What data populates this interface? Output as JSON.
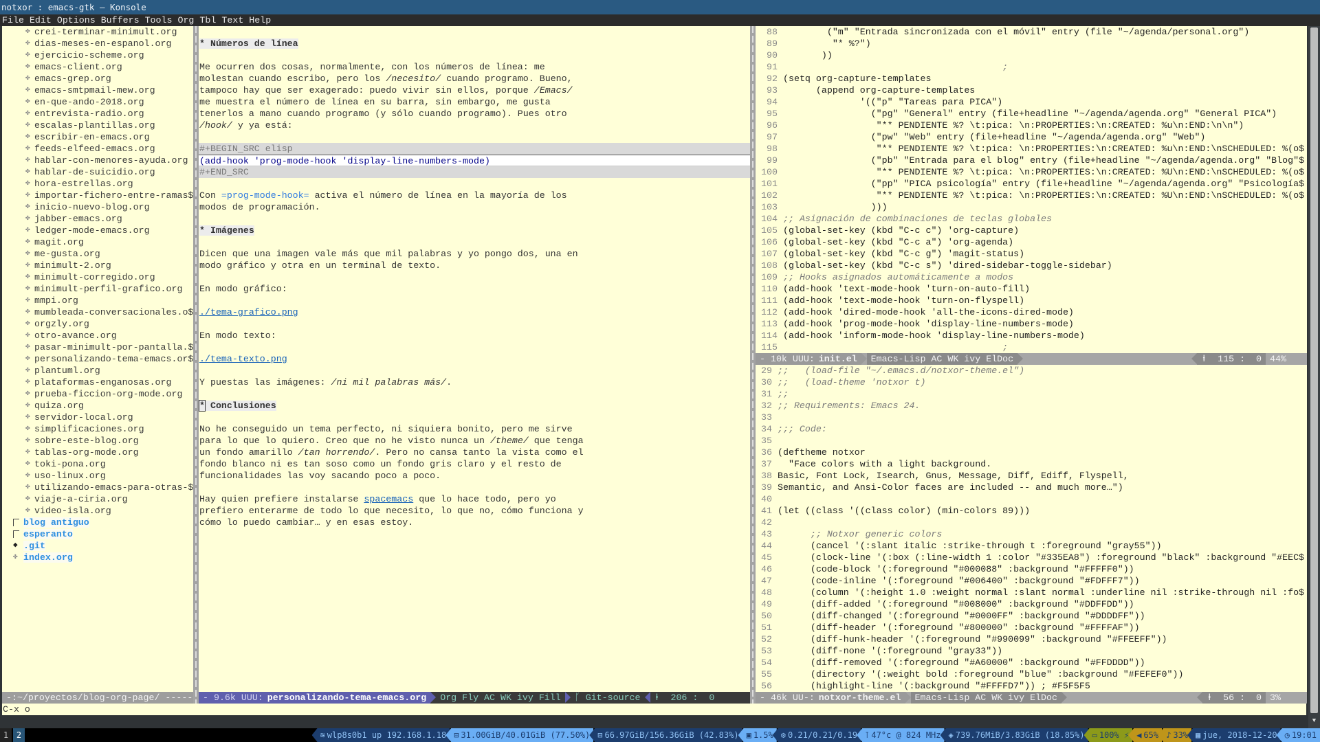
{
  "window": {
    "title": "notxor : emacs-gtk — Konsole"
  },
  "menu": [
    "File",
    "Edit",
    "Options",
    "Buffers",
    "Tools",
    "Org",
    "Tbl",
    "Text",
    "Help"
  ],
  "sidebar": {
    "items": [
      {
        "name": "crei-terminar-minimult.org",
        "type": "file"
      },
      {
        "name": "dias-meses-en-espanol.org",
        "type": "file"
      },
      {
        "name": "ejercicio-scheme.org",
        "type": "file"
      },
      {
        "name": "emacs-client.org",
        "type": "file"
      },
      {
        "name": "emacs-grep.org",
        "type": "file"
      },
      {
        "name": "emacs-smtpmail-mew.org",
        "type": "file"
      },
      {
        "name": "en-que-ando-2018.org",
        "type": "file"
      },
      {
        "name": "entrevista-radio.org",
        "type": "file"
      },
      {
        "name": "escalas-plantillas.org",
        "type": "file"
      },
      {
        "name": "escribir-en-emacs.org",
        "type": "file"
      },
      {
        "name": "feeds-elfeed-emacs.org",
        "type": "file"
      },
      {
        "name": "hablar-con-menores-ayuda.org",
        "type": "file"
      },
      {
        "name": "hablar-de-suicidio.org",
        "type": "file"
      },
      {
        "name": "hora-estrellas.org",
        "type": "file"
      },
      {
        "name": "importar-fichero-entre-ramas$",
        "type": "file"
      },
      {
        "name": "inicio-nuevo-blog.org",
        "type": "file"
      },
      {
        "name": "jabber-emacs.org",
        "type": "file"
      },
      {
        "name": "ledger-mode-emacs.org",
        "type": "file"
      },
      {
        "name": "magit.org",
        "type": "file"
      },
      {
        "name": "me-gusta.org",
        "type": "file"
      },
      {
        "name": "minimult-2.org",
        "type": "file"
      },
      {
        "name": "minimult-corregido.org",
        "type": "file"
      },
      {
        "name": "minimult-perfil-grafico.org",
        "type": "file"
      },
      {
        "name": "mmpi.org",
        "type": "file"
      },
      {
        "name": "mumbleada-conversacionales.o$",
        "type": "file"
      },
      {
        "name": "orgzly.org",
        "type": "file"
      },
      {
        "name": "otro-avance.org",
        "type": "file"
      },
      {
        "name": "pasar-minimult-por-pantalla.$",
        "type": "file"
      },
      {
        "name": "personalizando-tema-emacs.or$",
        "type": "file"
      },
      {
        "name": "plantuml.org",
        "type": "file"
      },
      {
        "name": "plataformas-enganosas.org",
        "type": "file"
      },
      {
        "name": "prueba-ficcion-org-mode.org",
        "type": "file"
      },
      {
        "name": "quiza.org",
        "type": "file"
      },
      {
        "name": "servidor-local.org",
        "type": "file"
      },
      {
        "name": "simplificaciones.org",
        "type": "file"
      },
      {
        "name": "sobre-este-blog.org",
        "type": "file"
      },
      {
        "name": "tablas-org-mode.org",
        "type": "file"
      },
      {
        "name": "toki-pona.org",
        "type": "file"
      },
      {
        "name": "uso-linux.org",
        "type": "file"
      },
      {
        "name": "utilizando-emacs-para-otras-$",
        "type": "file"
      },
      {
        "name": "viaje-a-ciria.org",
        "type": "file"
      },
      {
        "name": "video-isla.org",
        "type": "file"
      },
      {
        "name": "blog antiguo",
        "type": "dir"
      },
      {
        "name": "esperanto",
        "type": "dir"
      },
      {
        "name": ".git",
        "type": "git"
      },
      {
        "name": "index.org",
        "type": "root-file"
      }
    ],
    "modeline": "-:~/proyectos/blog-org-page/ ------"
  },
  "org_buffer": {
    "lines": [
      {
        "type": "blank",
        "segs": []
      },
      {
        "type": "text",
        "segs": [
          [
            "* Números de línea",
            "h"
          ]
        ]
      },
      {
        "type": "blank",
        "segs": []
      },
      {
        "type": "text",
        "segs": [
          [
            "Me ocurren dos cosas, normalmente, con los números de línea: me",
            ""
          ]
        ]
      },
      {
        "type": "text",
        "segs": [
          [
            "molestan cuando escribo, pero los ",
            ""
          ],
          [
            "/necesito/",
            "i"
          ],
          [
            " cuando programo. Bueno,",
            ""
          ]
        ]
      },
      {
        "type": "text",
        "segs": [
          [
            "tampoco hay que ser exagerado: puedo vivir sin ellos, porque ",
            ""
          ],
          [
            "/Emacs/",
            "i"
          ]
        ]
      },
      {
        "type": "text",
        "segs": [
          [
            "me muestra el número de línea en su barra, sin embargo, me gusta",
            ""
          ]
        ]
      },
      {
        "type": "text",
        "segs": [
          [
            "tenerlos a mano cuando programo (y sólo cuando programo). Pues otro",
            ""
          ]
        ]
      },
      {
        "type": "text",
        "segs": [
          [
            "/hook/",
            "i"
          ],
          [
            " y ya está:",
            ""
          ]
        ]
      },
      {
        "type": "blank",
        "segs": []
      },
      {
        "type": "src",
        "segs": [
          [
            "#+BEGIN_SRC elisp",
            ""
          ]
        ]
      },
      {
        "type": "cur",
        "segs": [
          [
            "(add-hook 'prog-mode-hook 'display-line-numbers-mode)",
            ""
          ]
        ]
      },
      {
        "type": "src",
        "segs": [
          [
            "#+END_SRC",
            ""
          ]
        ]
      },
      {
        "type": "blank",
        "segs": []
      },
      {
        "type": "text",
        "segs": [
          [
            "Con ",
            ""
          ],
          [
            "=prog-mode-hook=",
            "v"
          ],
          [
            " activa el número de línea en la mayoría de los",
            ""
          ]
        ]
      },
      {
        "type": "text",
        "segs": [
          [
            "modos de programación.",
            ""
          ]
        ]
      },
      {
        "type": "blank",
        "segs": []
      },
      {
        "type": "text",
        "segs": [
          [
            "* Imágenes",
            "h"
          ]
        ]
      },
      {
        "type": "blank",
        "segs": []
      },
      {
        "type": "text",
        "segs": [
          [
            "Dicen que una imagen vale más que mil palabras y yo pongo dos, una en",
            ""
          ]
        ]
      },
      {
        "type": "text",
        "segs": [
          [
            "modo gráfico y otra en un terminal de texto.",
            ""
          ]
        ]
      },
      {
        "type": "blank",
        "segs": []
      },
      {
        "type": "text",
        "segs": [
          [
            "En modo gráfico:",
            ""
          ]
        ]
      },
      {
        "type": "blank",
        "segs": []
      },
      {
        "type": "text",
        "segs": [
          [
            "./tema-grafico.png",
            "l"
          ]
        ]
      },
      {
        "type": "blank",
        "segs": []
      },
      {
        "type": "text",
        "segs": [
          [
            "En modo texto:",
            ""
          ]
        ]
      },
      {
        "type": "blank",
        "segs": []
      },
      {
        "type": "text",
        "segs": [
          [
            "./tema-texto.png",
            "l"
          ]
        ]
      },
      {
        "type": "blank",
        "segs": []
      },
      {
        "type": "text",
        "segs": [
          [
            "Y puestas las imágenes: ",
            ""
          ],
          [
            "/ni mil palabras más/",
            "i"
          ],
          [
            ".",
            ""
          ]
        ]
      },
      {
        "type": "blank",
        "segs": []
      },
      {
        "type": "text",
        "segs": [
          [
            "*",
            "hcur"
          ],
          [
            " Conclusiones",
            "h"
          ]
        ]
      },
      {
        "type": "blank",
        "segs": []
      },
      {
        "type": "text",
        "segs": [
          [
            "No he conseguido un tema perfecto, ni siquiera bonito, pero me sirve",
            ""
          ]
        ]
      },
      {
        "type": "text",
        "segs": [
          [
            "para lo que lo quiero. Creo que no he visto nunca un ",
            ""
          ],
          [
            "/theme/",
            "i"
          ],
          [
            " que tenga",
            ""
          ]
        ]
      },
      {
        "type": "text",
        "segs": [
          [
            "un fondo amarillo ",
            ""
          ],
          [
            "/tan horrendo/",
            "i"
          ],
          [
            ". Pero no cansa tanto la vista como el",
            ""
          ]
        ]
      },
      {
        "type": "text",
        "segs": [
          [
            "fondo blanco ni es tan soso como un fondo gris claro y el resto de",
            ""
          ]
        ]
      },
      {
        "type": "text",
        "segs": [
          [
            "funcionalidades las voy sacando poco a poco.",
            ""
          ]
        ]
      },
      {
        "type": "blank",
        "segs": []
      },
      {
        "type": "text",
        "segs": [
          [
            "Hay quien prefiere instalarse ",
            ""
          ],
          [
            "spacemacs",
            "l"
          ],
          [
            " que lo hace todo, pero yo",
            ""
          ]
        ]
      },
      {
        "type": "text",
        "segs": [
          [
            "prefiero enterarme de todo lo que necesito, lo que no, cómo funciona y",
            ""
          ]
        ]
      },
      {
        "type": "text",
        "segs": [
          [
            "cómo lo puedo cambiar… y en esas estoy.",
            ""
          ]
        ]
      }
    ],
    "modeline": {
      "state": "- 9.6k UUU:",
      "file": "personalizando-tema-emacs.org",
      "modes": "Org Fly AC WK ivy Fill",
      "vcs_icon": "git-branch-icon",
      "vcs": "Git-source",
      "position": "206 :  0"
    }
  },
  "init_el": {
    "gutter_width": 3,
    "lines": [
      [
        "88",
        "        (\"m\" \"Entrada sincronizada con el móvil\" entry (file \"~/agenda/personal.org\")"
      ],
      [
        "89",
        "         \"* %?\")"
      ],
      [
        "90",
        "       ))"
      ],
      [
        "91",
        "                                        ;"
      ],
      [
        "92",
        "(setq org-capture-templates"
      ],
      [
        "93",
        "      (append org-capture-templates"
      ],
      [
        "94",
        "              '((\"p\" \"Tareas para PICA\")"
      ],
      [
        "95",
        "                (\"pg\" \"General\" entry (file+headline \"~/agenda/agenda.org\" \"General PICA\")"
      ],
      [
        "96",
        "                 \"** PENDIENTE %? \\t:pica: \\n:PROPERTIES:\\n:CREATED: %u\\n:END:\\n\\n\")"
      ],
      [
        "97",
        "                (\"pw\" \"Web\" entry (file+headline \"~/agenda/agenda.org\" \"Web\")"
      ],
      [
        "98",
        "                 \"** PENDIENTE %? \\t:pica: \\n:PROPERTIES:\\n:CREATED: %u\\n:END:\\nSCHEDULED: %(o$"
      ],
      [
        "99",
        "                (\"pb\" \"Entrada para el blog\" entry (file+headline \"~/agenda/agenda.org\" \"Blog\"$"
      ],
      [
        "100",
        "                 \"** PENDIENTE %? \\t:pica: \\n:PROPERTIES:\\n:CREATED: %U\\n:END:\\nSCHEDULED: %(o$"
      ],
      [
        "101",
        "                (\"pp\" \"PICA psicología\" entry (file+headline \"~/agenda/agenda.org\" \"Psicología$"
      ],
      [
        "102",
        "                 \"** PENDIENTE %? \\t:pica: \\n:PROPERTIES:\\n:CREATED: %U\\n:END:\\nSCHEDULED: %(o$"
      ],
      [
        "103",
        "                )))"
      ],
      [
        "104",
        ";; Asignación de combinaciones de teclas globales"
      ],
      [
        "105",
        "(global-set-key (kbd \"C-c c\") 'org-capture)"
      ],
      [
        "106",
        "(global-set-key (kbd \"C-c a\") 'org-agenda)"
      ],
      [
        "107",
        "(global-set-key (kbd \"C-c g\") 'magit-status)"
      ],
      [
        "108",
        "(global-set-key (kbd \"C-c s\") 'dired-sidebar-toggle-sidebar)"
      ],
      [
        "109",
        ";; Hooks asignados automáticamente a modos"
      ],
      [
        "110",
        "(add-hook 'text-mode-hook 'turn-on-auto-fill)"
      ],
      [
        "111",
        "(add-hook 'text-mode-hook 'turn-on-flyspell)"
      ],
      [
        "112",
        "(add-hook 'dired-mode-hook 'all-the-icons-dired-mode)"
      ],
      [
        "113",
        "(add-hook 'prog-mode-hook 'display-line-numbers-mode)"
      ],
      [
        "114",
        "(add-hook 'inform-mode-hook 'display-line-numbers-mode)"
      ],
      [
        "115",
        "                                        ;"
      ]
    ],
    "modeline": {
      "state": "- 10k UUU:",
      "file": "init.el",
      "modes": "Emacs-Lisp AC WK ivy ElDoc",
      "position": "115 :  0",
      "percent": "44%"
    }
  },
  "theme_el": {
    "gutter_width": 2,
    "lines": [
      [
        "29",
        ";;   (load-file \"~/.emacs.d/notxor-theme.el\")"
      ],
      [
        "30",
        ";;   (load-theme 'notxor t)"
      ],
      [
        "31",
        ";;"
      ],
      [
        "32",
        ";; Requirements: Emacs 24."
      ],
      [
        "33",
        ""
      ],
      [
        "34",
        ";;; Code:"
      ],
      [
        "35",
        ""
      ],
      [
        "36",
        "(deftheme notxor"
      ],
      [
        "37",
        "  \"Face colors with a light background."
      ],
      [
        "38",
        "Basic, Font Lock, Isearch, Gnus, Message, Diff, Ediff, Flyspell,"
      ],
      [
        "39",
        "Semantic, and Ansi-Color faces are included -- and much more…\")"
      ],
      [
        "40",
        ""
      ],
      [
        "41",
        "(let ((class '((class color) (min-colors 89)))"
      ],
      [
        "42",
        ""
      ],
      [
        "43",
        "      ;; Notxor generic colors"
      ],
      [
        "44",
        "      (cancel '(:slant italic :strike-through t :foreground \"gray55\"))"
      ],
      [
        "45",
        "      (clock-line '(:box (:line-width 1 :color \"#335EA8\") :foreground \"black\" :background \"#EEC$"
      ],
      [
        "46",
        "      (code-block '(:foreground \"#000088\" :background \"#FFFFF0\"))"
      ],
      [
        "47",
        "      (code-inline '(:foreground \"#006400\" :background \"#FDFFF7\"))"
      ],
      [
        "48",
        "      (column '(:height 1.0 :weight normal :slant normal :underline nil :strike-through nil :fo$"
      ],
      [
        "49",
        "      (diff-added '(:foreground \"#008000\" :background \"#DDFFDD\"))"
      ],
      [
        "50",
        "      (diff-changed '(:foreground \"#0000FF\" :background \"#DDDDFF\"))"
      ],
      [
        "51",
        "      (diff-header '(:foreground \"#800000\" :background \"#FFFFAF\"))"
      ],
      [
        "52",
        "      (diff-hunk-header '(:foreground \"#990099\" :background \"#FFEEFF\"))"
      ],
      [
        "53",
        "      (diff-none '(:foreground \"gray33\"))"
      ],
      [
        "54",
        "      (diff-removed '(:foreground \"#A60000\" :background \"#FFDDDD\"))"
      ],
      [
        "55",
        "      (directory '(:weight bold :foreground \"blue\" :background \"#FEFEF0\"))"
      ],
      [
        "56",
        "      (highlight-line '(:background \"#FFFFD7\")) ; #F5F5F5"
      ]
    ],
    "modeline": {
      "state": "- 46k UU-:",
      "file": "notxor-theme.el",
      "modes": "Emacs-Lisp AC WK ivy ElDoc",
      "position": "56 :  0",
      "percent": "3%"
    }
  },
  "minibuffer": "C-x o",
  "statusbar": {
    "workspaces": [
      {
        "label": "1",
        "active": false
      },
      {
        "label": "2",
        "active": true
      }
    ],
    "blocks": [
      {
        "icon": "wifi-icon",
        "glyph": "≋",
        "text": "wlp8s0b1 up 192.168.1.18",
        "style": "bd"
      },
      {
        "icon": "disk-icon",
        "glyph": "⊟",
        "text": "31.00GiB/40.01GiB (77.50%)",
        "style": "bl"
      },
      {
        "icon": "disk-icon",
        "glyph": "⊟",
        "text": "66.97GiB/156.36GiB (42.83%)",
        "style": "bd"
      },
      {
        "icon": "cpu-icon",
        "glyph": "▣",
        "text": "1.5%",
        "style": "bl"
      },
      {
        "icon": "load-gears-icon",
        "glyph": "⚙",
        "text": "0.21/0.21/0.19",
        "style": "bd"
      },
      {
        "icon": "thermometer-icon",
        "glyph": "⊺",
        "text": "47°c @ 824 MHz",
        "style": "bl"
      },
      {
        "icon": "memory-icon",
        "glyph": "◈",
        "text": "739.76MiB/3.83GiB (18.85%)",
        "style": "bd"
      },
      {
        "icon": "battery-plug-icon",
        "glyph": "▭",
        "text": "100% ⚡",
        "style": "bo"
      },
      {
        "icon": "volume-icon",
        "glyph": "◀",
        "text": "65%",
        "style": "by"
      },
      {
        "icon": "microphone-icon",
        "glyph": "♪",
        "text": "33%",
        "style": "by"
      },
      {
        "icon": "calendar-icon",
        "glyph": "▦",
        "text": "jue, 2018-12-20",
        "style": "bd"
      },
      {
        "icon": "clock-icon",
        "glyph": "◷",
        "text": "19:01",
        "style": "bl"
      }
    ]
  },
  "colors": {
    "buffer_bg": "#FFFFD8",
    "active_modeline": "#5F5FAD",
    "inactive_modeline": "#A6A6A6",
    "title_bar": "#2A5A82"
  }
}
